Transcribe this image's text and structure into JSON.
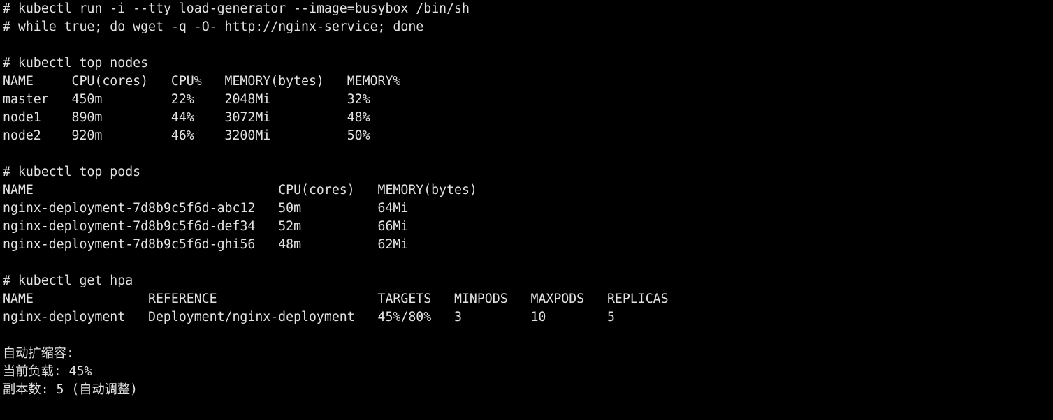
{
  "commands": {
    "run": "# kubectl run -i --tty load-generator --image=busybox /bin/sh",
    "loop": "# while true; do wget -q -O- http://nginx-service; done",
    "top_nodes": "# kubectl top nodes",
    "top_pods": "# kubectl top pods",
    "get_hpa": "# kubectl get hpa"
  },
  "nodes": {
    "headers": [
      "NAME",
      "CPU(cores)",
      "CPU%",
      "MEMORY(bytes)",
      "MEMORY%"
    ],
    "rows": [
      [
        "master",
        "450m",
        "22%",
        "2048Mi",
        "32%"
      ],
      [
        "node1",
        "890m",
        "44%",
        "3072Mi",
        "48%"
      ],
      [
        "node2",
        "920m",
        "46%",
        "3200Mi",
        "50%"
      ]
    ]
  },
  "pods": {
    "headers": [
      "NAME",
      "CPU(cores)",
      "MEMORY(bytes)"
    ],
    "rows": [
      [
        "nginx-deployment-7d8b9c5f6d-abc12",
        "50m",
        "64Mi"
      ],
      [
        "nginx-deployment-7d8b9c5f6d-def34",
        "52m",
        "66Mi"
      ],
      [
        "nginx-deployment-7d8b9c5f6d-ghi56",
        "48m",
        "62Mi"
      ]
    ]
  },
  "hpa": {
    "headers": [
      "NAME",
      "REFERENCE",
      "TARGETS",
      "MINPODS",
      "MAXPODS",
      "REPLICAS"
    ],
    "rows": [
      [
        "nginx-deployment",
        "Deployment/nginx-deployment",
        "45%/80%",
        "3",
        "10",
        "5"
      ]
    ]
  },
  "summary": {
    "title": "自动扩缩容:",
    "load": "当前负载: 45%",
    "replicas": "副本数: 5 (自动调整)"
  },
  "colors": {
    "background": "#000000",
    "text": "#e2e2e2"
  }
}
